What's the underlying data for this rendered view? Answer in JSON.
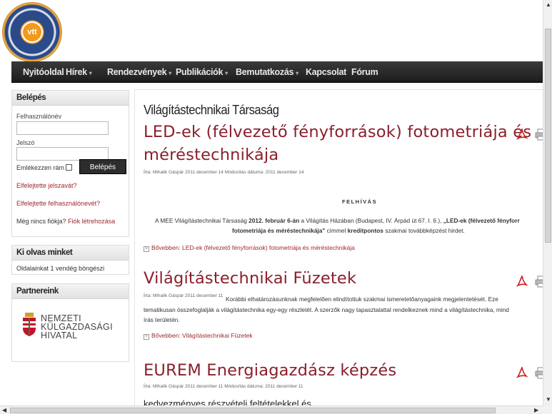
{
  "nav": {
    "items": [
      {
        "label": "Nyitóoldal",
        "dropdown": false
      },
      {
        "label": "Hírek",
        "dropdown": true
      },
      {
        "label": "Rendezvények",
        "dropdown": true
      },
      {
        "label": "Publikációk",
        "dropdown": true
      },
      {
        "label": "Bemutatkozás",
        "dropdown": true
      },
      {
        "label": "Kapcsolat",
        "dropdown": false
      },
      {
        "label": "Fórum",
        "dropdown": false
      }
    ],
    "caret": "▾"
  },
  "login": {
    "title": "Belépés",
    "username_label": "Felhasználónév",
    "password_label": "Jelszó",
    "remember_label": "Emlékezzen rám",
    "button": "Belépés",
    "forgot_password": "Elfelejtette jelszavát?",
    "forgot_username": "Elfelejtette felhasználónevét?",
    "no_account": "Még nincs fiókja?",
    "create_account": "Fiók létrehozása"
  },
  "online": {
    "title": "Ki olvas minket",
    "text": "Oldalainkat 1 vendég böngészi"
  },
  "partners": {
    "title": "Partnereink",
    "logo_lines": [
      "NEMZETI",
      "KÜLGAZDASÁGI",
      "HIVATAL"
    ]
  },
  "main": {
    "category_title": "Világítástechnikai Társaság",
    "articles": [
      {
        "title_line1": "LED-ek (félvezető fényforrások) fotometriája és",
        "title_line2": "méréstechnikája",
        "meta": "Írta: Mihalik Gáspár  2011 december 14  Módosítás dátuma: 2011 december 14",
        "heading": "FELHÍVÁS",
        "text_pre": "A MEE Világítástechnikai Társaság ",
        "text_date": "2012. február 6-án",
        "text_mid": " a Világítás Házában (Budapest, IV. Árpád út 67. I. 6.), ",
        "text_bold": "„LED-ek (félvezető fényforr",
        "text_line2_bold": "fotometriája és méréstechnikája\"",
        "text_line2_mid": " címmel ",
        "text_line2_bold2": "kreditpontos",
        "text_line2_end": " szakmai továbbképzést hirdet.",
        "readmore": "Bővebben: LED-ek (félvezető fényforrások) fotometriája és méréstechnikája"
      },
      {
        "title": "Világítástechnikai Füzetek",
        "meta": "Írta: Mihalik Gáspár  2011 december 11",
        "text_line1": "Korábbi elhatározásunknak megfelelően elindítottuk szakmai ismeretetőanyagaink megjelentetését. Eze",
        "text_line2": "tematikusan összefoglalják a világítástechnika egy-egy részletét. A szerzők nagy tapasztalattal rendelkeznek mind a világítástechnika, mind",
        "text_line3": "írás területén.",
        "readmore": "Bővebben: Világítástechnikai Füzetek"
      },
      {
        "title": "EUREM Energiagazdász képzés",
        "meta": "Írta: Mihalik Gáspár  2011 december 11  Módosítás dátuma: 2011 december 11",
        "text": "kedvezményes részvételi feltételekkel és"
      }
    ]
  },
  "colors": {
    "accent": "#8a1f2b",
    "link": "#a0282d",
    "navbar": "#262626"
  },
  "icons": [
    "pdf-icon",
    "print-icon",
    "vtt-logo",
    "nkh-logo-shield"
  ]
}
